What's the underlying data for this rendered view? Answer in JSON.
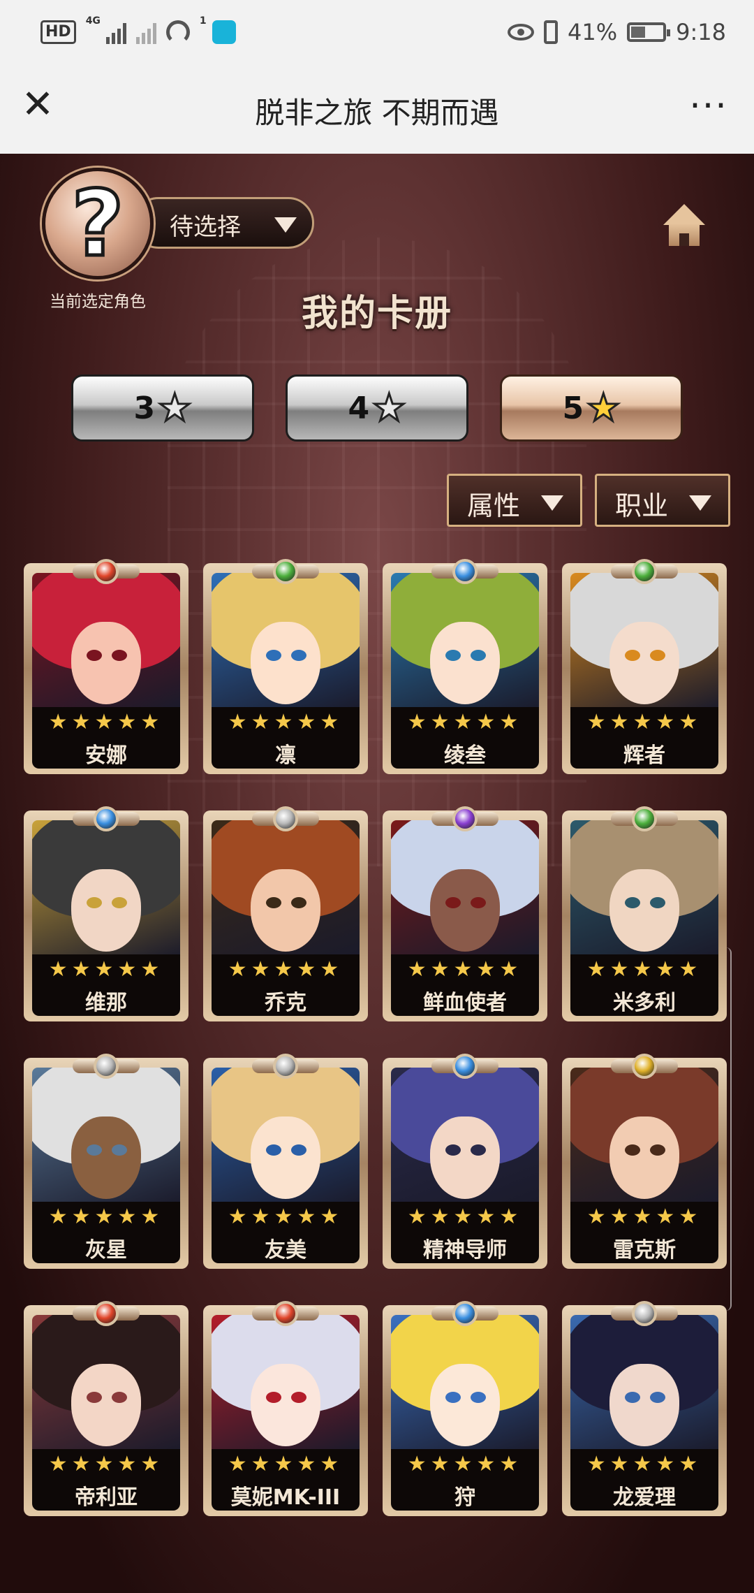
{
  "status_bar": {
    "hd": "HD",
    "net": "4G",
    "wifi_badge": "1",
    "battery": "41%",
    "time": "9:18"
  },
  "title_bar": {
    "close_icon": "close-icon",
    "title": "脱非之旅 不期而遇",
    "more_icon": "more-icon"
  },
  "header": {
    "avatar_glyph": "?",
    "select_label": "待选择",
    "avatar_caption": "当前选定角色",
    "home_icon": "home-icon",
    "page_title": "我的卡册"
  },
  "rarity_tabs": [
    {
      "label": "3",
      "star": "★",
      "active": false
    },
    {
      "label": "4",
      "star": "★",
      "active": false
    },
    {
      "label": "5",
      "star": "★",
      "active": true
    }
  ],
  "filters": {
    "attribute": "属性",
    "job": "职业"
  },
  "cards": [
    {
      "name": "安娜",
      "stars": "★★★★★",
      "element": "fire"
    },
    {
      "name": "凛",
      "stars": "★★★★★",
      "element": "wind"
    },
    {
      "name": "绫叁",
      "stars": "★★★★★",
      "element": "water"
    },
    {
      "name": "辉者",
      "stars": "★★★★★",
      "element": "wind"
    },
    {
      "name": "维那",
      "stars": "★★★★★",
      "element": "water"
    },
    {
      "name": "乔克",
      "stars": "★★★★★",
      "element": "neutral"
    },
    {
      "name": "鲜血使者",
      "stars": "★★★★★",
      "element": "dark"
    },
    {
      "name": "米多利",
      "stars": "★★★★★",
      "element": "wind"
    },
    {
      "name": "灰星",
      "stars": "★★★★★",
      "element": "neutral"
    },
    {
      "name": "友美",
      "stars": "★★★★★",
      "element": "neutral"
    },
    {
      "name": "精神导师",
      "stars": "★★★★★",
      "element": "water"
    },
    {
      "name": "雷克斯",
      "stars": "★★★★★",
      "element": "thunder"
    },
    {
      "name": "帝利亚",
      "stars": "★★★★★",
      "element": "fire"
    },
    {
      "name": "莫妮MK-III",
      "stars": "★★★★★",
      "element": "fire"
    },
    {
      "name": "狩",
      "stars": "★★★★★",
      "element": "water"
    },
    {
      "name": "龙爱理",
      "stars": "★★★★★",
      "element": "neutral"
    }
  ],
  "colors": {
    "fire": "#e0452a",
    "wind": "#4caf3c",
    "water": "#3a8fe0",
    "dark": "#8a3fd1",
    "thunder": "#e0b12a",
    "neutral": "#b9b9b9"
  }
}
